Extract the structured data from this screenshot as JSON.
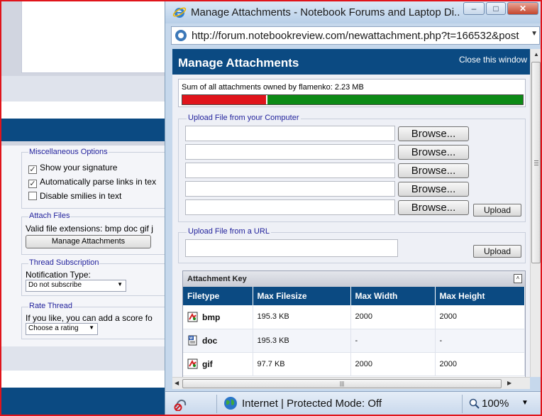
{
  "background_page": {
    "misc_options": {
      "legend": "Miscellaneous Options",
      "show_signature": "Show your signature",
      "parse_links": "Automatically parse links in tex",
      "disable_smilies": "Disable smilies in text"
    },
    "attach_files": {
      "legend": "Attach Files",
      "valid_extensions": "Valid file extensions: bmp doc gif j",
      "manage_button": "Manage Attachments"
    },
    "thread_subscription": {
      "legend": "Thread Subscription",
      "notification_label": "Notification Type:",
      "selected": "Do not subscribe"
    },
    "rate_thread": {
      "legend": "Rate Thread",
      "prompt": "If you like, you can add a score fo",
      "selected": "Choose a rating"
    }
  },
  "window": {
    "title": "Manage Attachments - Notebook Forums and Laptop Di...",
    "minimize": "–",
    "maximize": "□",
    "close": "✕",
    "address": "http://forum.notebookreview.com/newattachment.php?t=166532&post"
  },
  "page": {
    "title": "Manage Attachments",
    "close_link": "Close this window",
    "sum_text": "Sum of all attachments owned by flamenko: 2.23 MB",
    "usage_fraction": 0.25,
    "upload_computer": {
      "legend": "Upload File from your Computer",
      "browse_label": "Browse...",
      "upload_label": "Upload"
    },
    "upload_url": {
      "legend": "Upload File from a URL",
      "upload_label": "Upload"
    },
    "attachment_key": {
      "title": "Attachment Key",
      "collapse": "˄",
      "columns": [
        "Filetype",
        "Max Filesize",
        "Max Width",
        "Max Height"
      ],
      "rows": [
        {
          "type": "bmp",
          "size": "195.3 KB",
          "width": "2000",
          "height": "2000",
          "icon": "image-file-icon"
        },
        {
          "type": "doc",
          "size": "195.3 KB",
          "width": "-",
          "height": "-",
          "icon": "word-file-icon"
        },
        {
          "type": "gif",
          "size": "97.7 KB",
          "width": "2000",
          "height": "2000",
          "icon": "image-file-icon"
        }
      ]
    }
  },
  "scrollbar": {
    "grip": "|||"
  },
  "status": {
    "zone": "Internet | Protected Mode: Off",
    "zoom": "100%"
  },
  "colors": {
    "header_navy": "#0b4a82",
    "used_red": "#e0141b",
    "free_green": "#0d8a16",
    "legend_blue": "#22229c"
  }
}
